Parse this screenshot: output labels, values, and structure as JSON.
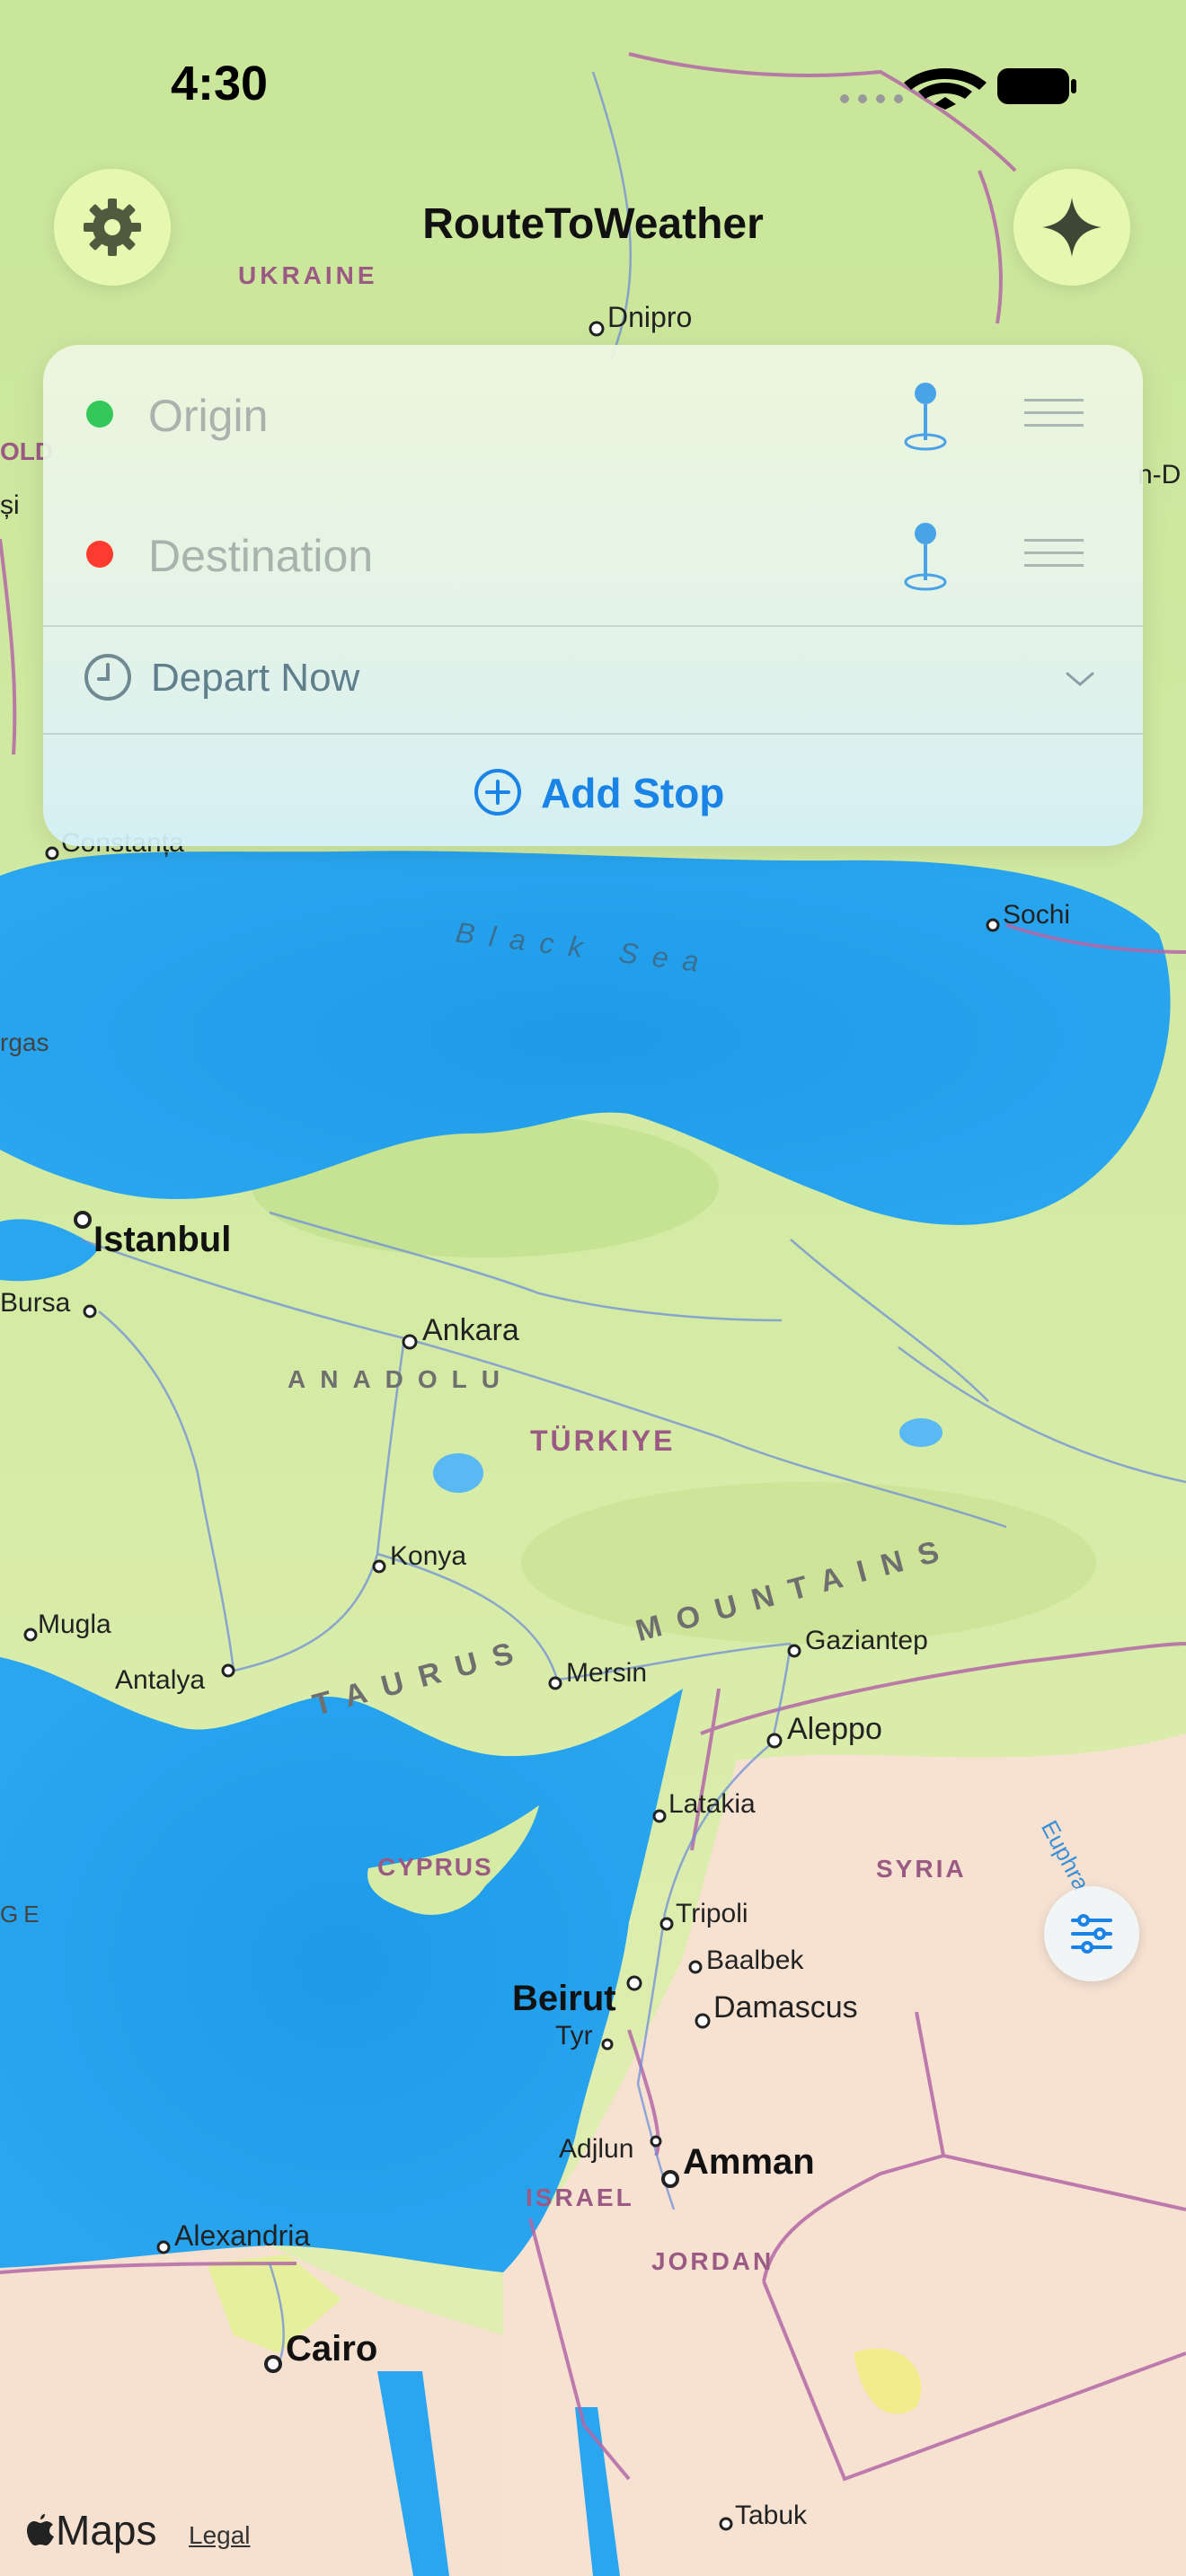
{
  "status_bar": {
    "time": "4:30"
  },
  "header": {
    "title": "RouteToWeather",
    "settings_icon": "gear-icon",
    "ai_icon": "sparkle-icon"
  },
  "route": {
    "origin": {
      "placeholder": "Origin",
      "dot_color": "#34c759"
    },
    "destination": {
      "placeholder": "Destination",
      "dot_color": "#ff3b30"
    },
    "depart": {
      "label": "Depart Now"
    },
    "add_stop": {
      "label": "Add Stop"
    },
    "accent": "#1a83e6"
  },
  "map": {
    "sea": "Black Sea",
    "regions": [
      "UKRAINE",
      "TÜRKIYE",
      "SYRIA",
      "CYPRUS",
      "ISRAEL",
      "JORDAN"
    ],
    "areas": [
      "ANADOLU",
      "TAURUS",
      "MOUNTAINS"
    ],
    "rivers": [
      "Euphra"
    ],
    "cities": [
      "Dnipro",
      "Constanța",
      "Sochi",
      "Istanbul",
      "Bursa",
      "Ankara",
      "Konya",
      "Mugla",
      "Antalya",
      "Mersin",
      "Gaziantep",
      "Aleppo",
      "Latakia",
      "Tripoli",
      "Baalbek",
      "Beirut",
      "Damascus",
      "Tyr",
      "Adjlun",
      "Amman",
      "Alexandria",
      "Cairo",
      "Tabuk"
    ],
    "edge_labels": [
      "OLD",
      "și",
      "n-D",
      "rgas",
      "GE"
    ]
  },
  "footer": {
    "maps_label": "Maps",
    "legal_label": "Legal"
  }
}
